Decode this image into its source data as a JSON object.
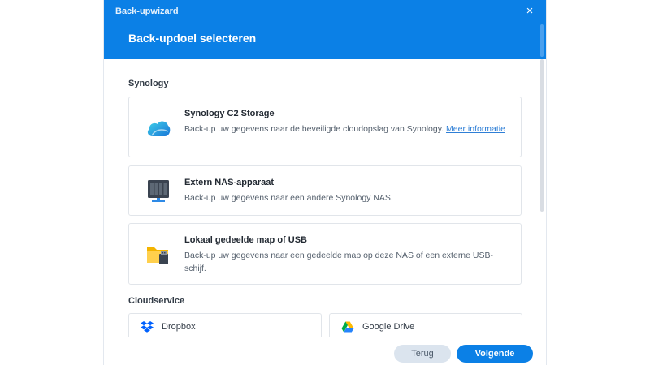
{
  "window": {
    "title": "Back-upwizard",
    "close_label": "×"
  },
  "page": {
    "title": "Back-updoel selecteren"
  },
  "sections": {
    "synology": {
      "title": "Synology",
      "cards": [
        {
          "title": "Synology C2 Storage",
          "description": "Back-up uw gegevens naar de beveiligde cloudopslag van Synology.",
          "link": "Meer informatie",
          "icon": "c2-cloud-icon"
        },
        {
          "title": "Extern NAS-apparaat",
          "description": "Back-up uw gegevens naar een andere Synology NAS.",
          "icon": "nas-device-icon"
        },
        {
          "title": "Lokaal gedeelde map of USB",
          "description": "Back-up uw gegevens naar een gedeelde map op deze NAS of een externe USB-schijf.",
          "icon": "folder-usb-icon"
        }
      ]
    },
    "cloud": {
      "title": "Cloudservice",
      "items": [
        {
          "label": "Dropbox",
          "icon": "dropbox-icon"
        },
        {
          "label": "Google Drive",
          "icon": "google-drive-icon"
        }
      ]
    }
  },
  "footer": {
    "back_label": "Terug",
    "next_label": "Volgende"
  },
  "colors": {
    "accent": "#0b80e6",
    "link": "#2f7fd6",
    "border": "#e1e5ea"
  }
}
